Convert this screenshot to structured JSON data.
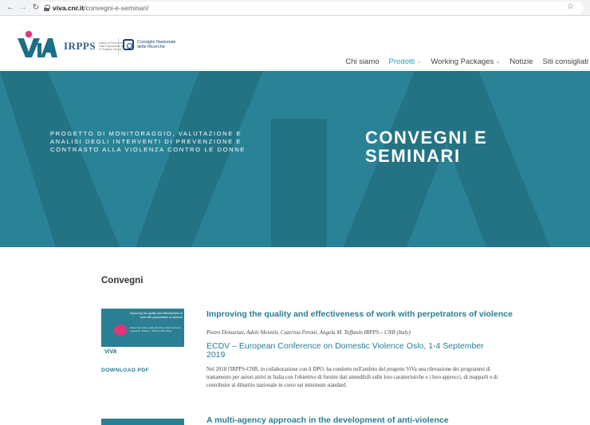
{
  "browser": {
    "back_icon": "arrow-left",
    "forward_icon": "arrow-right",
    "reload_icon": "reload",
    "url_domain": "viva.cnr.it",
    "url_path": "/convegni-e-seminari/",
    "bookmark_icon": "star"
  },
  "header": {
    "irpps_logo_text": "IRPPS",
    "irpps_subtitle": "Istituto di Ricerche sulla Popolazione e le Politiche Sociali",
    "cnr_text": "Consiglio Nazionale delle Ricerche",
    "menu": [
      {
        "label": "Chi siamo",
        "active": false,
        "dropdown": false
      },
      {
        "label": "Prodotti",
        "active": true,
        "dropdown": true
      },
      {
        "label": "Working Packages",
        "active": false,
        "dropdown": true
      },
      {
        "label": "Notizie",
        "active": false,
        "dropdown": false
      },
      {
        "label": "Siti consigliati",
        "active": false,
        "dropdown": false
      }
    ]
  },
  "hero": {
    "subtitle": "PROGETTO DI MONITORAGGIO, VALUTAZIONE E ANALISI DEGLI INTERVENTI DI PREVENZIONE E CONTRASTO ALLA VIOLENZA CONTRO LE DONNE",
    "title": "CONVEGNI E SEMINARI",
    "background_color": "#2a8296"
  },
  "content": {
    "section_title": "Convegni",
    "items": [
      {
        "thumb_title": "Improving the quality and effectiveness of work with perpetrators of violence",
        "thumb_meta": "Pietro Demurtas, Adele Menniti, Caterina Peroni, Angela M. Toffanin · IRPPS-CNR (Italy)",
        "thumb_logo": "ViVA",
        "download_label": "DOWNLOAD PDF",
        "title": "Improving the quality and effectiveness of work with perpetrators of violence",
        "authors": "Pietro Demurtas, Adele Menniti, Caterina Peroni, Angela M. Toffanin IRPPS – CNR (Italy)",
        "event": "ECDV – European Conference on Domestic Violence Oslo, 1-4 September 2019",
        "description": "Nel 2018 l'IRPPS-CNR, in collaborazione con il DPO, ha condotto nell'ambito del progetto ViVa una rilevazione dei programmi di trattamento per autori attivi in Italia con l'obiettivo di fornire dati attendibili sulle loro caratteristiche e i loro approcci, di mapparli e di contribuire al dibattito nazionale in corso sui minimum standard."
      },
      {
        "thumb_title": "",
        "title": "A multi-agency approach in the development of anti-violence"
      }
    ]
  },
  "colors": {
    "accent": "#2a7d93",
    "menu_active": "#1ba6c2",
    "viva_pink": "#e1367a"
  }
}
